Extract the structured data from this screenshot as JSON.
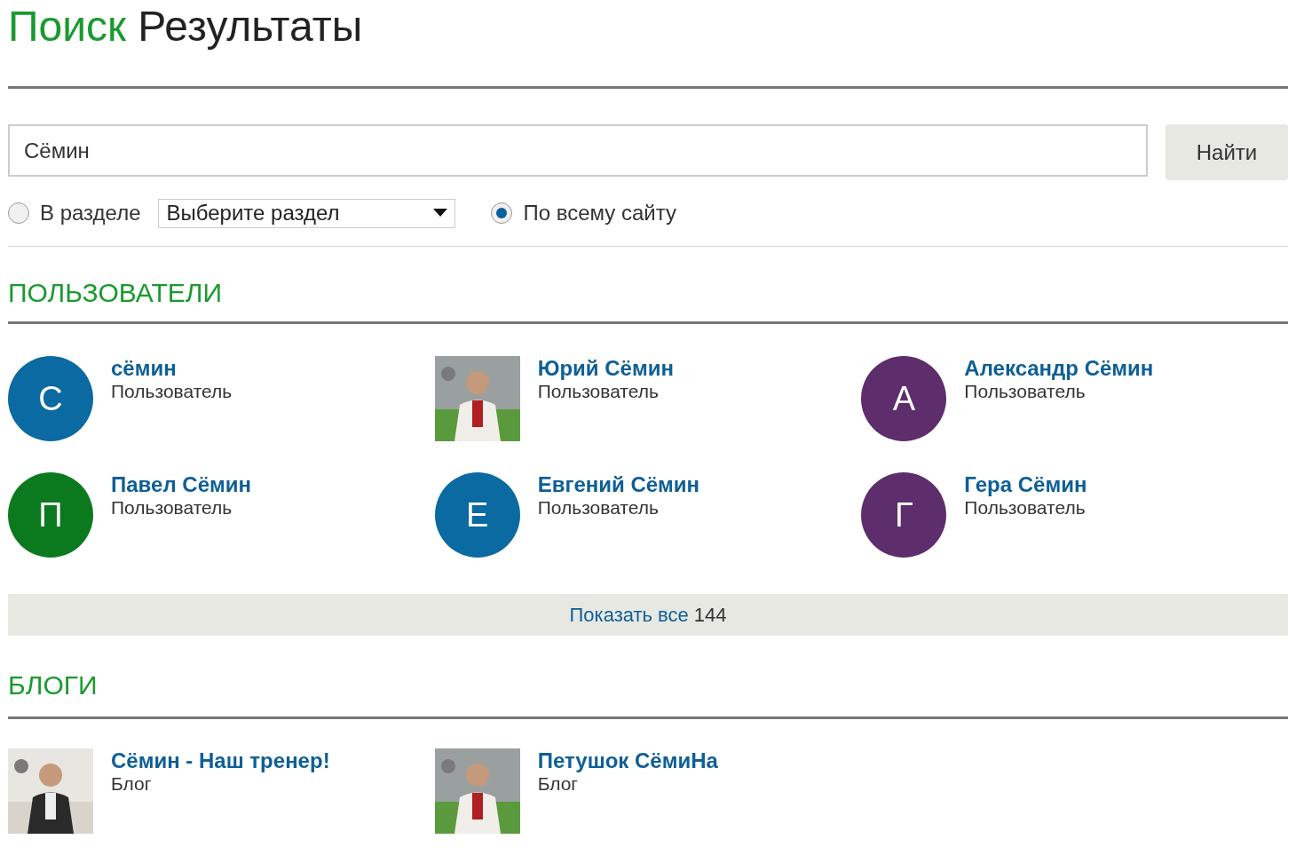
{
  "title": {
    "accent": "Поиск",
    "rest": "Результаты"
  },
  "search": {
    "value": "Сёмин",
    "button": "Найти"
  },
  "scope": [
    {
      "kind": "section",
      "label": "В разделе",
      "selected": false,
      "select": "Выберите раздел"
    },
    {
      "kind": "site",
      "label": "По всему сайту",
      "selected": true
    }
  ],
  "users": {
    "heading": "ПОЛЬЗОВАТЕЛИ",
    "items": [
      {
        "name": "сёмин",
        "role": "Пользователь",
        "avatar": {
          "kind": "letter",
          "letter": "С",
          "color": "#0a6aa1"
        }
      },
      {
        "name": "Юрий Сёмин",
        "role": "Пользователь"
      },
      {
        "name": "Александр Сёмин",
        "role": "Пользователь",
        "avatar": {
          "kind": "letter",
          "letter": "А",
          "color": "#5e2d6b"
        }
      },
      {
        "name": "Павел Сёмин",
        "role": "Пользователь",
        "avatar": {
          "kind": "letter",
          "letter": "П",
          "color": "#0b7a1e"
        }
      },
      {
        "name": "Евгений Сёмин",
        "role": "Пользователь",
        "avatar": {
          "kind": "letter",
          "letter": "Е",
          "color": "#0a6aa1"
        }
      },
      {
        "name": "Гера Сёмин",
        "role": "Пользователь",
        "avatar": {
          "kind": "letter",
          "letter": "Г",
          "color": "#5e2d6b"
        }
      }
    ],
    "show_all": {
      "label": "Показать все",
      "count": "144"
    }
  },
  "blogs": {
    "heading": "БЛОГИ",
    "items": [
      {
        "name": "Сёмин - Наш тренер!",
        "role": "Блог"
      },
      {
        "name": "Петушок СёмиНа",
        "role": "Блог"
      }
    ]
  }
}
